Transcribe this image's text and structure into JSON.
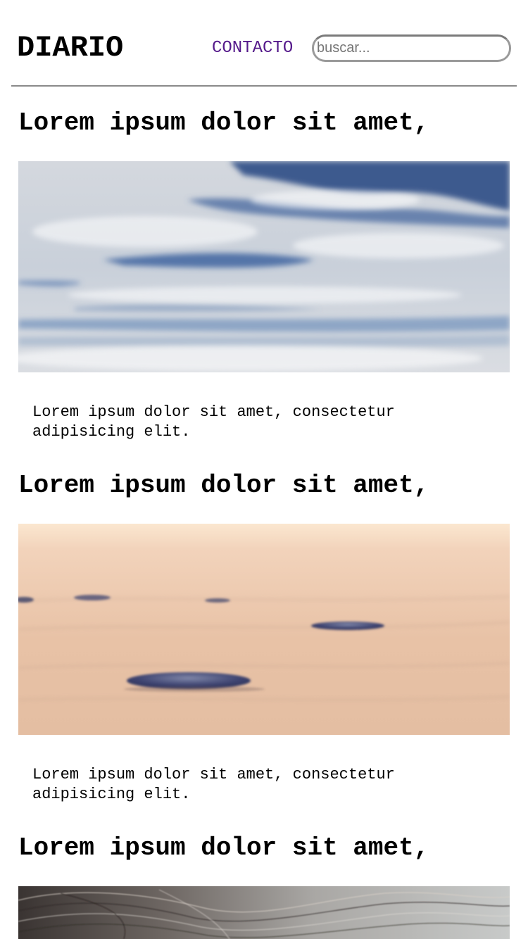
{
  "header": {
    "logo": "DIARIO",
    "nav_link": "CONTACTO",
    "search_placeholder": "buscar..."
  },
  "articles": [
    {
      "title": "Lorem ipsum dolor sit amet,",
      "excerpt": "Lorem ipsum dolor sit amet, consectetur adipisicing elit.",
      "image": "cloudy-sky-photo"
    },
    {
      "title": "Lorem ipsum dolor sit amet,",
      "excerpt": "Lorem ipsum dolor sit amet, consectetur adipisicing elit.",
      "image": "sand-stones-photo"
    },
    {
      "title": "Lorem ipsum dolor sit amet,",
      "excerpt": "",
      "image": "rippled-texture-photo"
    }
  ],
  "colors": {
    "link": "#551a8b",
    "divider": "#8a8a8a"
  }
}
